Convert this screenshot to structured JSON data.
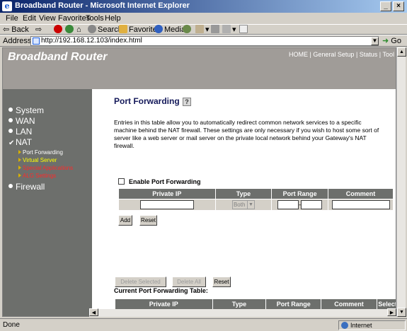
{
  "window": {
    "title": "Broadband Router - Microsoft Internet Explorer"
  },
  "menu": [
    "File",
    "Edit",
    "View",
    "Favorites",
    "Tools",
    "Help"
  ],
  "toolbar": {
    "back": "Back",
    "search": "Search",
    "favorites": "Favorites",
    "media": "Media"
  },
  "address": {
    "label": "Address",
    "url": "http://192.168.12.103/index.html",
    "go": "Go"
  },
  "header": {
    "brand": "Broadband Router",
    "nav": [
      "HOME",
      "General Setup",
      "Status",
      "Tool"
    ]
  },
  "sidebar": {
    "main": [
      "System",
      "WAN",
      "LAN",
      "NAT",
      "Firewall"
    ],
    "sub": [
      {
        "label": "Port Forwarding",
        "color": "#ffffff"
      },
      {
        "label": "Virtual Server",
        "color": "#ffff00"
      },
      {
        "label": "Special Applications",
        "color": "#ff2a2a"
      },
      {
        "label": "ALG Settings",
        "color": "#ff2a2a"
      }
    ]
  },
  "content": {
    "title": "Port Forwarding",
    "description": "Entries in this table allow you to automatically redirect common network services to a specific machine behind the NAT firewall. These settings are only necessary if you wish to host some sort of server like a web server or mail server on the private local network behind your Gateway's NAT firewall.",
    "enable_label": "Enable Port Forwarding",
    "columns": [
      "Private IP",
      "Type",
      "Port Range",
      "Comment"
    ],
    "type_value": "Both",
    "port_sep": "-",
    "add": "Add",
    "reset": "Reset",
    "current_title": "Current Port Forwarding Table:",
    "current_columns": [
      "Private IP",
      "Type",
      "Port Range",
      "Comment",
      "Select"
    ],
    "delete_selected": "Delete Selected",
    "delete_all": "Delete All",
    "reset2": "Reset"
  },
  "status": {
    "text": "Done",
    "zone": "Internet"
  }
}
